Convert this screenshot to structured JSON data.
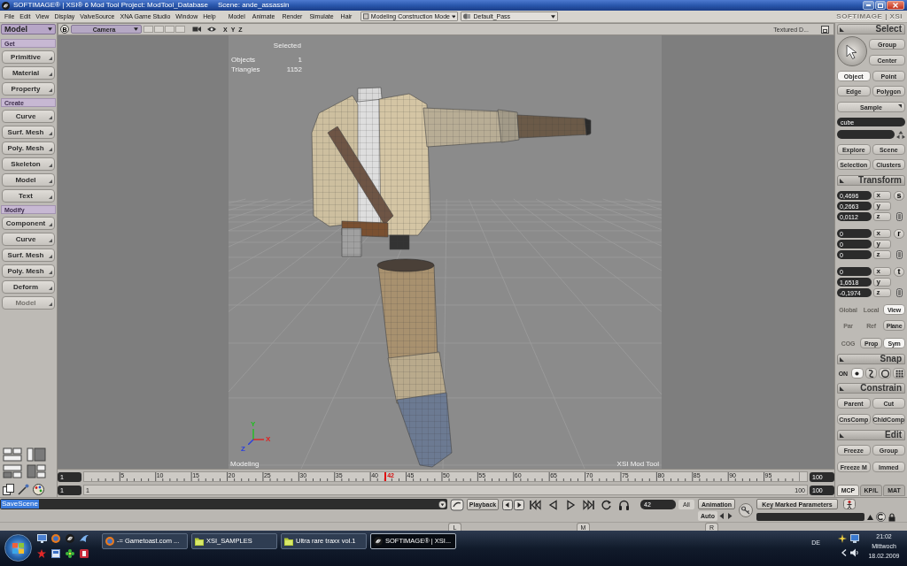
{
  "title_bar": {
    "title": "SOFTIMAGE® | XSI® 6 Mod Tool Project: ModTool_Database",
    "scene": "Scene: ande_assassin"
  },
  "menu_bar": {
    "menus": [
      "File",
      "Edit",
      "View",
      "Display",
      "ValveSource",
      "XNA Game Studio",
      "Window",
      "Help"
    ],
    "module_menus": [
      "Model",
      "Animate",
      "Render",
      "Simulate",
      "Hair"
    ],
    "mode_dropdown": "Modeling Construction Mode",
    "pass_dropdown": "Default_Pass",
    "logo": "SOFTIMAGE | XSI"
  },
  "left_panel": {
    "toolbar": "Model",
    "sections": [
      {
        "title": "Get",
        "buttons": [
          {
            "label": "Primitive",
            "disabled": false
          },
          {
            "label": "Material",
            "disabled": false
          },
          {
            "label": "Property",
            "disabled": false
          }
        ]
      },
      {
        "title": "Create",
        "buttons": [
          {
            "label": "Curve",
            "disabled": false
          },
          {
            "label": "Surf. Mesh",
            "disabled": false
          },
          {
            "label": "Poly. Mesh",
            "disabled": false
          },
          {
            "label": "Skeleton",
            "disabled": false
          },
          {
            "label": "Model",
            "disabled": false
          },
          {
            "label": "Text",
            "disabled": false
          }
        ]
      },
      {
        "title": "Modify",
        "buttons": [
          {
            "label": "Component",
            "disabled": false
          },
          {
            "label": "Curve",
            "disabled": false
          },
          {
            "label": "Surf. Mesh",
            "disabled": false
          },
          {
            "label": "Poly. Mesh",
            "disabled": false
          },
          {
            "label": "Deform",
            "disabled": false
          },
          {
            "label": "Model",
            "disabled": true
          }
        ]
      }
    ]
  },
  "viewport": {
    "header": {
      "view_button": "B",
      "camera": "Camera",
      "axes": [
        "X",
        "Y",
        "Z"
      ],
      "display_mode": "Textured D..."
    },
    "stats_title": "Selected",
    "stats": [
      {
        "label": "Objects",
        "value": "1"
      },
      {
        "label": "Triangles",
        "value": "1152"
      }
    ],
    "gizmo": [
      {
        "label": "Y",
        "color": "#1fc01f"
      },
      {
        "label": "X",
        "color": "#e02020"
      },
      {
        "label": "Z",
        "color": "#2a3ee0"
      }
    ],
    "mode_label": "Modeling",
    "corner_label": "XSI Mod Tool"
  },
  "timeline": {
    "start": "1",
    "end": "100",
    "tick_labels": [
      "5",
      "10",
      "15",
      "20",
      "25",
      "30",
      "35",
      "40",
      "45",
      "50",
      "55",
      "60",
      "65",
      "70",
      "75",
      "80",
      "85",
      "90",
      "95"
    ],
    "current_frame": "42",
    "level": 0.414
  },
  "range": {
    "start": "1",
    "end": "100",
    "start_label": "1",
    "end_label": "100"
  },
  "right_panel": {
    "select": {
      "title": "Select",
      "side_buttons": [
        "Group",
        "Center"
      ],
      "filters": [
        {
          "label": "Object",
          "selected": true
        },
        {
          "label": "Point",
          "selected": false
        },
        {
          "label": "Edge",
          "selected": false
        },
        {
          "label": "Polygon",
          "selected": false
        }
      ],
      "sample": "Sample",
      "selection": "cube",
      "buttons": [
        "Explore",
        "Scene",
        "Selection",
        "Clusters"
      ]
    },
    "transform": {
      "title": "Transform",
      "groups": [
        {
          "tool": "s",
          "fields": [
            {
              "axis": "x",
              "value": "0,4696"
            },
            {
              "axis": "y",
              "value": "0,2663"
            },
            {
              "axis": "z",
              "value": "0,0112"
            }
          ]
        },
        {
          "tool": "r",
          "fields": [
            {
              "axis": "x",
              "value": "0"
            },
            {
              "axis": "y",
              "value": "0"
            },
            {
              "axis": "z",
              "value": "0"
            }
          ]
        },
        {
          "tool": "t",
          "fields": [
            {
              "axis": "x",
              "value": "0"
            },
            {
              "axis": "y",
              "value": "1,6518"
            },
            {
              "axis": "z",
              "value": "-0,1974"
            }
          ]
        }
      ],
      "reference": [
        {
          "label": "Global",
          "disabled": true,
          "selected": false
        },
        {
          "label": "Local",
          "disabled": true,
          "selected": false
        },
        {
          "label": "View",
          "disabled": false,
          "selected": true
        },
        {
          "label": "Par",
          "disabled": true,
          "selected": false
        },
        {
          "label": "Ref",
          "disabled": true,
          "selected": false
        },
        {
          "label": "Plane",
          "disabled": false,
          "selected": false
        },
        {
          "label": "COG",
          "disabled": true,
          "selected": false
        },
        {
          "label": "Prop",
          "disabled": false,
          "selected": false
        },
        {
          "label": "Sym",
          "disabled": false,
          "selected": true
        }
      ]
    },
    "snap": {
      "title": "Snap",
      "on": "ON",
      "tools": [
        {
          "selected": true
        },
        {
          "selected": false
        },
        {
          "selected": false
        },
        {
          "selected": false
        }
      ]
    },
    "constrain": {
      "title": "Constrain",
      "buttons": [
        "Parent",
        "Cut",
        "CnsComp",
        "ChldComp"
      ]
    },
    "edit": {
      "title": "Edit",
      "buttons": [
        "Freeze",
        "Group",
        "Freeze M",
        "Immed"
      ]
    },
    "tabs": [
      {
        "label": "MCP",
        "selected": true
      },
      {
        "label": "KP/L",
        "selected": false
      },
      {
        "label": "MAT",
        "selected": false
      }
    ]
  },
  "command_bar": {
    "command": "SaveScene",
    "selected": true
  },
  "playback": {
    "playback_button": "Playback",
    "frame": "42",
    "all": "All",
    "animation": "Animation",
    "auto": "Auto",
    "key_button": "Key Marked Parameters"
  },
  "mouse_buttons": [
    "L",
    "M",
    "R"
  ],
  "taskbar": {
    "tasks": [
      {
        "label": "-= Gametoast.com ...",
        "kind": "browser",
        "selected": false
      },
      {
        "label": "XSI_SAMPLES",
        "kind": "folder",
        "selected": false
      },
      {
        "label": "Ultra rare traxx vol.1",
        "kind": "folder",
        "selected": false
      },
      {
        "label": "SOFTIMAGE® | XSI...",
        "kind": "app",
        "selected": true
      }
    ],
    "language": "DE",
    "time": "21:02",
    "day": "Mittwoch",
    "date": "18.02.2009"
  }
}
